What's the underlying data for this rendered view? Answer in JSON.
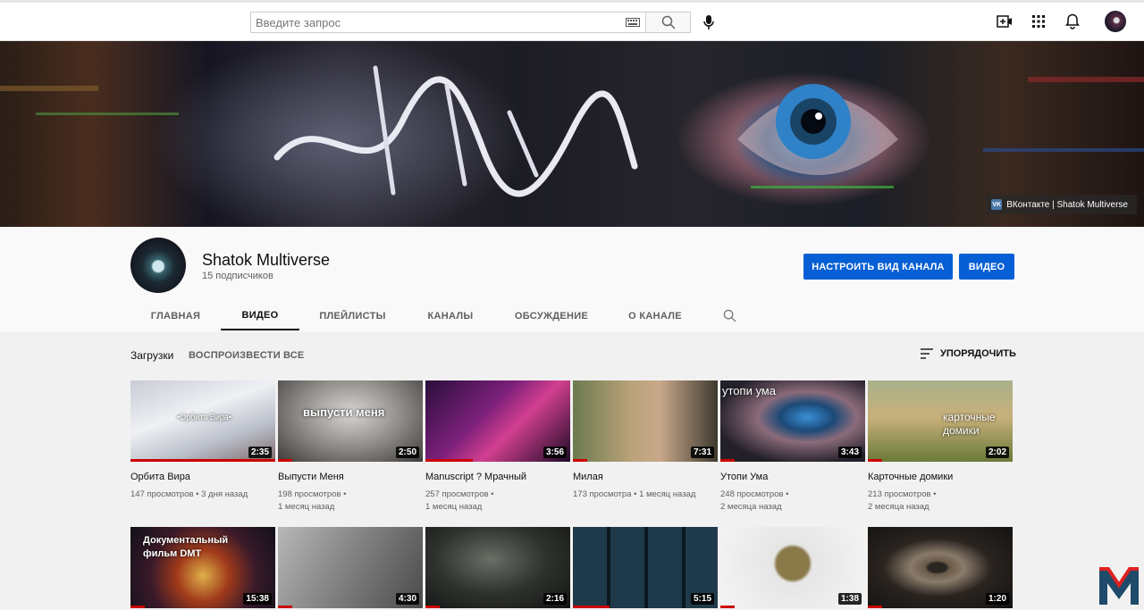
{
  "header": {
    "search_placeholder": "Введите запрос",
    "icons": [
      "keyboard-icon",
      "search-icon",
      "mic-icon",
      "create-video-icon",
      "apps-icon",
      "notifications-icon",
      "avatar"
    ]
  },
  "banner": {
    "tag_prefix": "VK",
    "tag_label": "ВКонтакте | Shatok Multiverse"
  },
  "channel": {
    "name": "Shatok Multiverse",
    "subscribers": "15 подписчиков",
    "customize_label": "НАСТРОИТЬ ВИД КАНАЛА",
    "video_label": "ВИДЕО",
    "tabs": [
      "ГЛАВНАЯ",
      "ВИДЕО",
      "ПЛЕЙЛИСТЫ",
      "КАНАЛЫ",
      "ОБСУЖДЕНИЕ",
      "О КАНАЛЕ"
    ],
    "active_tab": "ВИДЕО"
  },
  "uploads": {
    "title": "Загрузки",
    "play_all": "ВОСПРОИЗВЕСТИ ВСЕ",
    "sort_label": "УПОРЯДОЧИТЬ",
    "row1": [
      {
        "title": "Орбита Вира",
        "meta1": "147 просмотров • 3 дня назад",
        "meta2": "",
        "duration": "2:35",
        "overlay": "•Орбита Вира•",
        "progress": 1.0
      },
      {
        "title": "Выпусти Меня",
        "meta1": "198 просмотров •",
        "meta2": "1 месяц назад",
        "duration": "2:50",
        "overlay": "выпусти меня",
        "progress": 0.1
      },
      {
        "title": "Manuscript ? Мрачный",
        "meta1": "257 просмотров •",
        "meta2": "1 месяц назад",
        "duration": "3:56",
        "overlay": "",
        "progress": 0.33
      },
      {
        "title": "Милая",
        "meta1": "173 просмотра • 1 месяц назад",
        "meta2": "",
        "duration": "7:31",
        "overlay": "",
        "progress": 0.1
      },
      {
        "title": "Утопи Ума",
        "meta1": "248 просмотров •",
        "meta2": "2 месяца назад",
        "duration": "3:43",
        "overlay": "утопи ума",
        "progress": 0.1
      },
      {
        "title": "Карточные домики",
        "meta1": "213 просмотров •",
        "meta2": "2 месяца назад",
        "duration": "2:02",
        "overlay": "карточные домики",
        "progress": 0.1
      }
    ],
    "row2": [
      {
        "duration": "15:38",
        "overlay": "Документальный фильм DMT",
        "progress": 0.1
      },
      {
        "duration": "4:30",
        "overlay": "",
        "progress": 0.1
      },
      {
        "duration": "2:16",
        "overlay": "",
        "progress": 0.1
      },
      {
        "duration": "5:15",
        "overlay": "",
        "progress": 0.25
      },
      {
        "duration": "1:38",
        "overlay": "",
        "progress": 0.1
      },
      {
        "duration": "1:20",
        "overlay": "",
        "progress": 0.1
      }
    ]
  }
}
